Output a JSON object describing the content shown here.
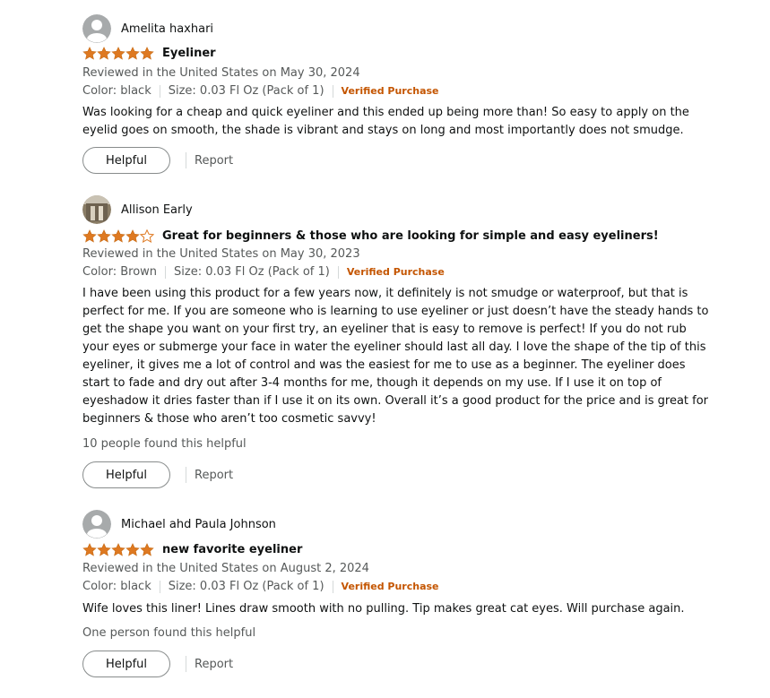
{
  "colors": {
    "star": "#de7921",
    "verified": "#c45500",
    "muted": "#565959",
    "text": "#0f1111"
  },
  "reviews": [
    {
      "author": "Amelita haxhari",
      "avatar": "default-avatar",
      "rating": 5,
      "title": "Eyeliner",
      "date_line": "Reviewed in the United States on May 30, 2024",
      "color": "Color: black",
      "size": "Size: 0.03 Fl Oz (Pack of 1)",
      "verified": "Verified Purchase",
      "body": "Was looking for a cheap and quick eyeliner and this ended up being more than! So easy to apply on the eyelid goes on smooth, the shade is vibrant and stays on long and most importantly does not smudge.",
      "helpful_count": "",
      "helpful_label": "Helpful",
      "report_label": "Report"
    },
    {
      "author": "Allison Early",
      "avatar": "photo-avatar",
      "rating": 4,
      "title": "Great for beginners & those who are looking for simple and easy eyeliners!",
      "date_line": "Reviewed in the United States on May 30, 2023",
      "color": "Color: Brown",
      "size": "Size: 0.03 Fl Oz (Pack of 1)",
      "verified": "Verified Purchase",
      "body": "I have been using this product for a few years now, it definitely is not smudge or waterproof, but that is perfect for me. If you are someone who is learning to use eyeliner or just doesn’t have the steady hands to get the shape you want on your first try, an eyeliner that is easy to remove is perfect! If you do not rub your eyes or submerge your face in water the eyeliner should last all day. I love the shape of the tip of this eyeliner, it gives me a lot of control and was the easiest for me to use as a beginner. The eyeliner does start to fade and dry out after 3-4 months for me, though it depends on my use. If I use it on top of eyeshadow it dries faster than if I use it on its own. Overall it’s a good product for the price and is great for beginners & those who aren’t too cosmetic savvy!",
      "helpful_count": "10 people found this helpful",
      "helpful_label": "Helpful",
      "report_label": "Report"
    },
    {
      "author": "Michael ahd Paula Johnson",
      "avatar": "default-avatar",
      "rating": 5,
      "title": "new favorite eyeliner",
      "date_line": "Reviewed in the United States on August 2, 2024",
      "color": "Color: black",
      "size": "Size: 0.03 Fl Oz (Pack of 1)",
      "verified": "Verified Purchase",
      "body": "Wife loves this liner! Lines draw smooth with no pulling. Tip makes great cat eyes. Will purchase again.",
      "helpful_count": "One person found this helpful",
      "helpful_label": "Helpful",
      "report_label": "Report"
    }
  ]
}
